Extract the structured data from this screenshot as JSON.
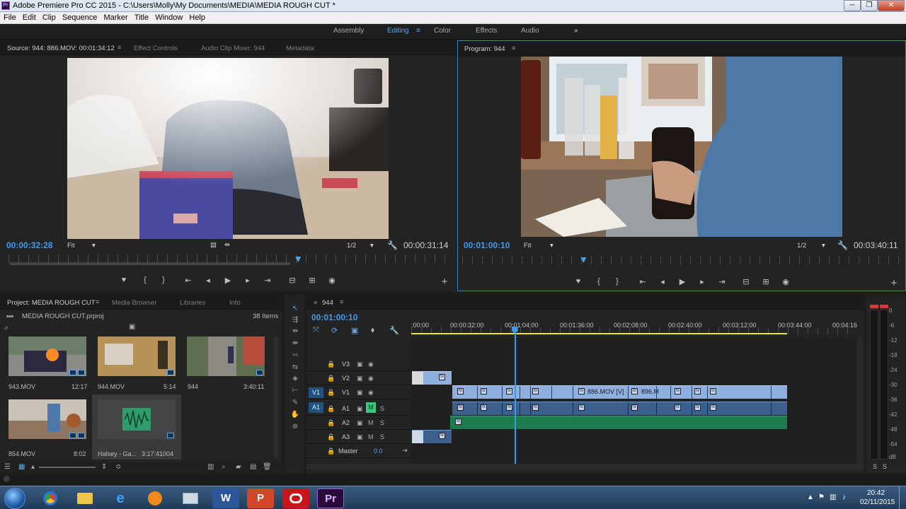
{
  "window": {
    "title": "Adobe Premiere Pro CC 2015 - C:\\Users\\Molly\\My Documents\\MEDIA\\MEDIA ROUGH CUT *",
    "app_icon": "Pr",
    "controls": [
      "─",
      "❐",
      "✕"
    ]
  },
  "menu": [
    "File",
    "Edit",
    "Clip",
    "Sequence",
    "Marker",
    "Title",
    "Window",
    "Help"
  ],
  "workspaces": {
    "items": [
      "Assembly",
      "Editing",
      "Color",
      "Effects",
      "Audio"
    ],
    "active": "Editing",
    "overflow": "»"
  },
  "source": {
    "tabs": [
      "Source: 944: 886.MOV: 00:01:34:12",
      "Effect Controls",
      "Audio Clip Mixer: 944",
      "Metadata"
    ],
    "timecode": "00:00:32:28",
    "fit": "Fit",
    "resolution": "1/2",
    "duration": "00:00:31:14",
    "playhead_fraction": 0.68
  },
  "program": {
    "tab": "Program: 944",
    "timecode": "00:01:00:10",
    "fit": "Fit",
    "resolution": "1/2",
    "duration": "00:03:40:11",
    "playhead_fraction": 0.27
  },
  "transport": {
    "marker": "♥",
    "in": "{",
    "out": "}",
    "go_in": "⇤",
    "step_back": "◂",
    "play": "▶",
    "step_fwd": "▸",
    "go_out": "⇥",
    "insert": "⊟",
    "overwrite": "⊞",
    "export": "◉",
    "add": "+"
  },
  "project": {
    "tabs": [
      "Project: MEDIA ROUGH CUT",
      "Media Browser",
      "Libraries",
      "Info"
    ],
    "file": "MEDIA ROUGH CUT.prproj",
    "item_count": "38 Items",
    "items": [
      {
        "name": "943.MOV",
        "duration": "12:17"
      },
      {
        "name": "944.MOV",
        "duration": "5:14"
      },
      {
        "name": "944",
        "duration": "3:40:11"
      },
      {
        "name": "854.MOV",
        "duration": "8:02"
      },
      {
        "name": "Halsey - Ga...",
        "duration": "3:17:41004"
      }
    ]
  },
  "timeline": {
    "tab": "944",
    "timecode": "00:01:00:10",
    "ruler_labels": [
      ":00:00",
      "00:00:32:00",
      "00:01:04:00",
      "00:01:36:00",
      "00:02:08:00",
      "00:02:40:00",
      "00:03:12:00",
      "00:03:44:00",
      "00:04:16"
    ],
    "video_tracks": [
      {
        "label": "V3",
        "target": ""
      },
      {
        "label": "V2",
        "target": ""
      },
      {
        "label": "V1",
        "target": "V1"
      }
    ],
    "audio_tracks": [
      {
        "label": "A1",
        "target": "A1",
        "m": "M",
        "s": "S"
      },
      {
        "label": "A2",
        "target": "",
        "m": "M",
        "s": "S"
      },
      {
        "label": "A3",
        "target": "",
        "m": "M",
        "s": "S"
      }
    ],
    "master": {
      "label": "Master",
      "value": "0.0"
    },
    "clip_labels": [
      "886.MOV [V]",
      "896.M"
    ],
    "playhead_fraction": 0.27
  },
  "meter": {
    "ticks": [
      "0",
      "-6",
      "-12",
      "-18",
      "-24",
      "-30",
      "-36",
      "-42",
      "-48",
      "-54",
      "dB"
    ],
    "solo": [
      "S",
      "S"
    ]
  },
  "taskbar": {
    "apps": [
      "chrome",
      "explorer",
      "ie",
      "media",
      "files",
      "W",
      "P",
      "adobe",
      "Pr"
    ],
    "time": "20:42",
    "date": "02/11/2015"
  }
}
